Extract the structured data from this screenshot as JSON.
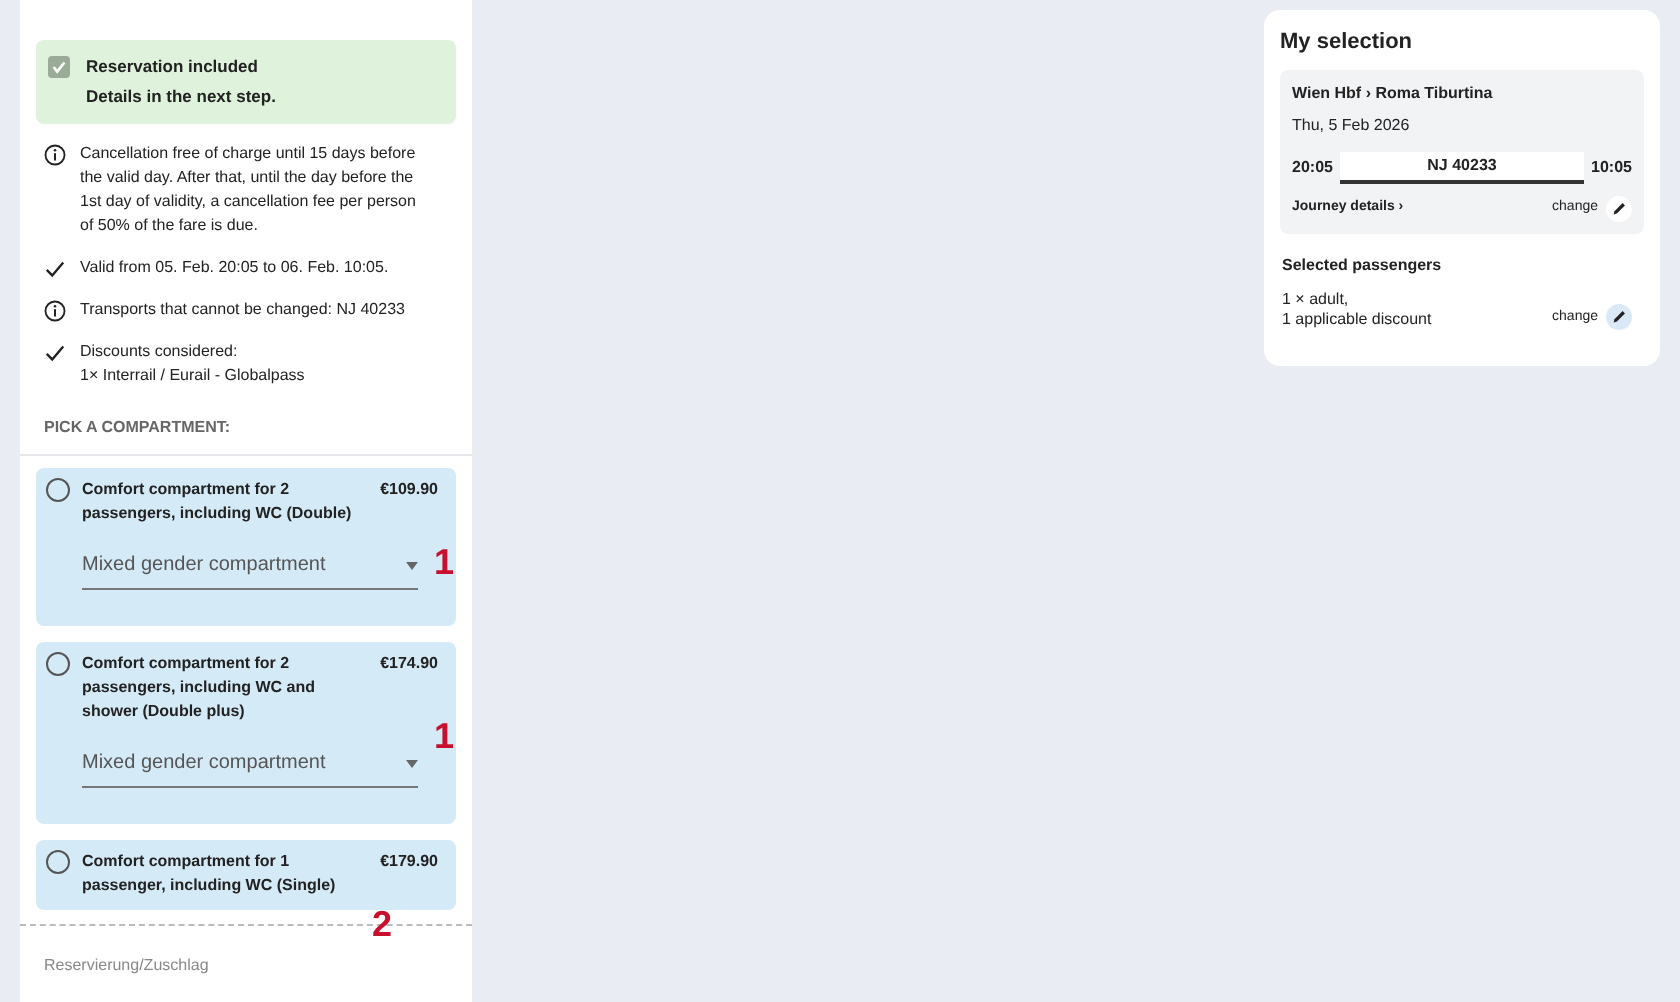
{
  "reservation": {
    "checked": true,
    "title": "Reservation included",
    "subtitle": "Details in the next step."
  },
  "conditions": [
    {
      "kind": "info",
      "text": "Cancellation free of charge until 15 days before the valid day. After that, until the day before the 1st day of validity, a cancellation fee per person of 50% of the fare is due."
    },
    {
      "kind": "check",
      "text": "Valid from 05. Feb. 20:05 to 06. Feb. 10:05."
    },
    {
      "kind": "info",
      "text": "Transports that cannot be changed: NJ 40233"
    },
    {
      "kind": "check",
      "text": "Discounts considered:\n1× Interrail / Eurail - Globalpass"
    }
  ],
  "compartment_heading": "PICK A COMPARTMENT:",
  "compartments": [
    {
      "selected": false,
      "title": "Comfort compartment for 2 passengers, including WC (Double)",
      "price": "€109.90",
      "dropdown": "Mixed gender compartment",
      "annotation": "1"
    },
    {
      "selected": false,
      "title": "Comfort compartment for 2 passengers, including WC and shower (Double plus)",
      "price": "€174.90",
      "dropdown": "Mixed gender compartment",
      "annotation": "1"
    },
    {
      "selected": false,
      "title": "Comfort compartment for 1 passenger, including WC (Single)",
      "price": "€179.90",
      "annotation": "2"
    }
  ],
  "footer_label": "Reservierung/Zuschlag",
  "selection": {
    "title": "My selection",
    "route": "Wien Hbf › Roma Tiburtina",
    "date": "Thu, 5 Feb 2026",
    "departure": "20:05",
    "train": "NJ 40233",
    "arrival": "10:05",
    "details_link": "Journey details ›",
    "change_label": "change",
    "passengers_heading": "Selected passengers",
    "passengers": "1 × adult,\n1 applicable discount",
    "passengers_change": "change"
  }
}
